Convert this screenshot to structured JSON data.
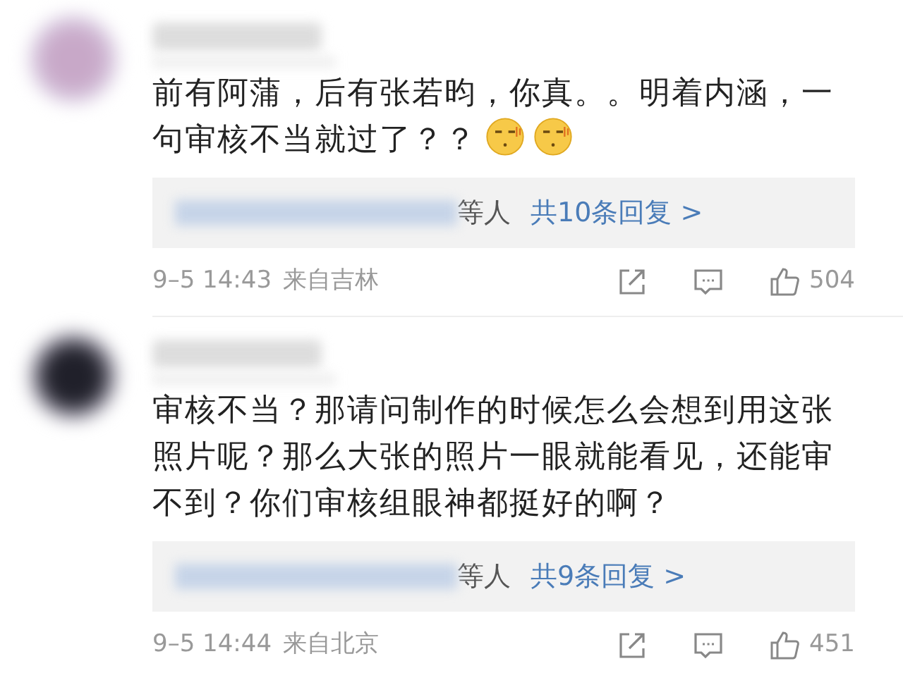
{
  "comments": [
    {
      "text": "前有阿蒲，后有张若昀，你真。。明着内涵，一句审核不当就过了？？",
      "emojis": [
        {
          "kind": "face"
        },
        {
          "kind": "face"
        }
      ],
      "replies": {
        "names_suffix": "等人",
        "link": "共10条回复 >"
      },
      "time": "9–5 14:43",
      "location": "来自吉林",
      "like_count": "504"
    },
    {
      "text": "审核不当？那请问制作的时候怎么会想到用这张照片呢？那么大张的照片一眼就能看见，还能审不到？你们审核组眼神都挺好的啊？",
      "replies": {
        "names_suffix": "等人",
        "link": "共9条回复 >"
      },
      "time": "9–5 14:44",
      "location": "来自北京",
      "like_count": "451"
    }
  ]
}
